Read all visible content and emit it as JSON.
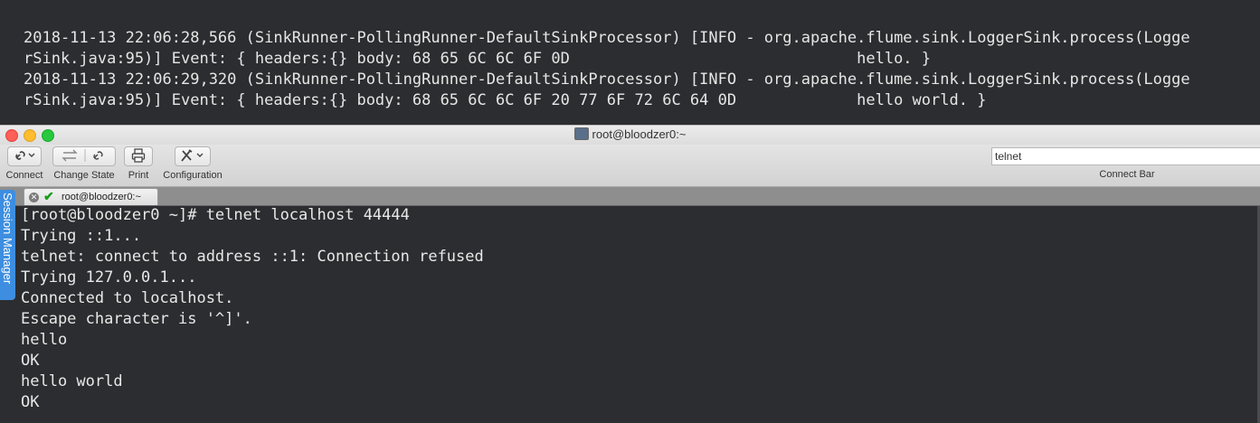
{
  "background_terminal": {
    "lines": [
      "2018-11-13 22:06:28,566 (SinkRunner-PollingRunner-DefaultSinkProcessor) [INFO - org.apache.flume.sink.LoggerSink.process(Logge",
      "rSink.java:95)] Event: { headers:{} body: 68 65 6C 6C 6F 0D                               hello. }",
      "2018-11-13 22:06:29,320 (SinkRunner-PollingRunner-DefaultSinkProcessor) [INFO - org.apache.flume.sink.LoggerSink.process(Logge",
      "rSink.java:95)] Event: { headers:{} body: 68 65 6C 6C 6F 20 77 6F 72 6C 64 0D             hello world. }"
    ]
  },
  "window": {
    "title": "root@bloodzer0:~"
  },
  "toolbar": {
    "connect_label": "Connect",
    "change_state_label": "Change State",
    "print_label": "Print",
    "configuration_label": "Configuration",
    "connect_bar_value": "telnet",
    "connect_bar_label": "Connect Bar"
  },
  "tabs": [
    {
      "label": "root@bloodzer0:~"
    }
  ],
  "session_manager_label": "Session Manager",
  "terminal": {
    "lines": [
      "[root@bloodzer0 ~]# telnet localhost 44444",
      "Trying ::1...",
      "telnet: connect to address ::1: Connection refused",
      "Trying 127.0.0.1...",
      "Connected to localhost.",
      "Escape character is '^]'.",
      "hello",
      "OK",
      "hello world",
      "OK"
    ]
  },
  "icons": {
    "connect": "link-icon",
    "change_state": "refresh-icon",
    "print": "printer-icon",
    "configuration": "tools-icon",
    "tab_close": "close-icon",
    "tab_status": "checkmark-icon"
  }
}
